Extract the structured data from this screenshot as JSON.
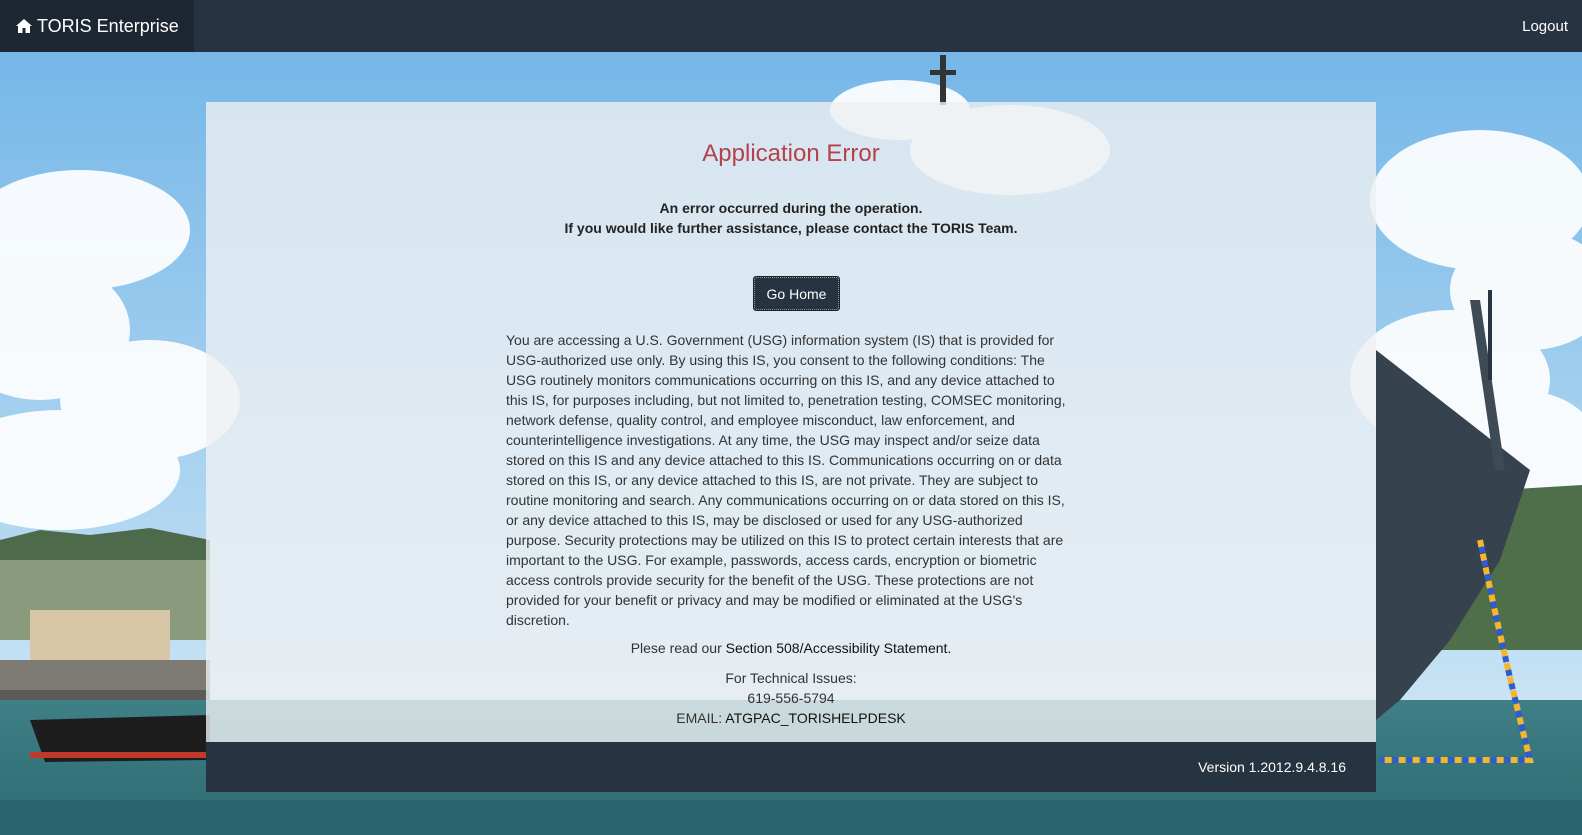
{
  "navbar": {
    "brand_label": "TORIS Enterprise",
    "brand_icon": "home-icon",
    "logout_label": "Logout",
    "background_color": "#263340"
  },
  "error": {
    "title": "Application Error",
    "title_color": "#b5414a",
    "message_line1": "An error occurred during the operation.",
    "message_line2": "If you would like further assistance, please contact the TORIS Team.",
    "go_home_label": "Go Home"
  },
  "notice": {
    "text": "You are accessing a U.S. Government (USG) information system (IS) that is provided for USG-authorized use only. By using this IS, you consent to the following conditions: The USG routinely monitors communications occurring on this IS, and any device attached to this IS, for purposes including, but not limited to, penetration testing, COMSEC monitoring, network defense, quality control, and employee misconduct, law enforcement, and counterintelligence investigations. At any time, the USG may inspect and/or seize data stored on this IS and any device attached to this IS. Communications occurring on or data stored on this IS, or any device attached to this IS, are not private. They are subject to routine monitoring and search. Any communications occurring on or data stored on this IS, or any device attached to this IS, may be disclosed or used for any USG-authorized purpose. Security protections may be utilized on this IS to protect certain interests that are important to the USG. For example, passwords, access cards, encryption or biometric access controls provide security for the benefit of the USG. These protections are not provided for your benefit or privacy and may be modified or eliminated at the USG's discretion.",
    "read_prefix": "Plese read our ",
    "read_link": "Section 508/Accessibility Statement."
  },
  "contact": {
    "heading": "For Technical Issues:",
    "phone": "619-556-5794",
    "email_label": "EMAIL: ",
    "email_link": "ATGPAC_TORISHELPDESK"
  },
  "footer": {
    "version": "Version 1.2012.9.4.8.16"
  }
}
